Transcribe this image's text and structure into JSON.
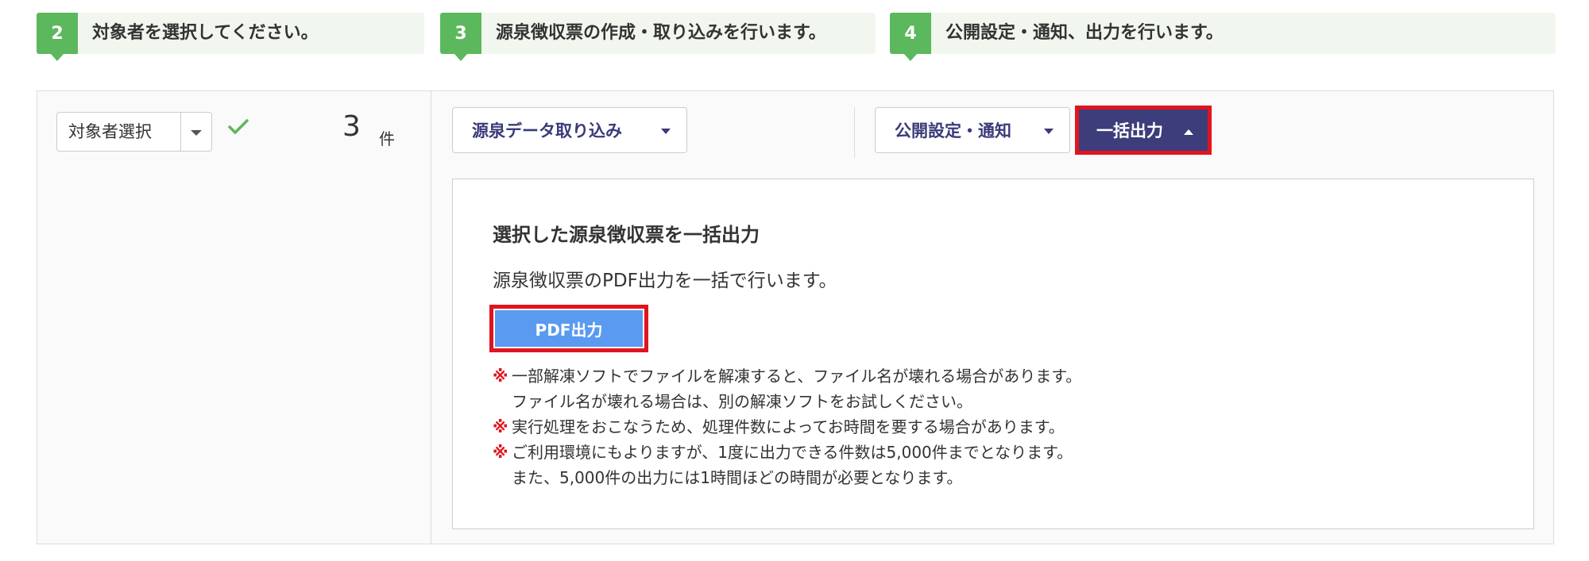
{
  "steps": [
    {
      "num": "2",
      "label": "対象者を選択してください。"
    },
    {
      "num": "3",
      "label": "源泉徴収票の作成・取り込みを行います。"
    },
    {
      "num": "4",
      "label": "公開設定・通知、出力を行います。"
    }
  ],
  "left": {
    "select_label": "対象者選択",
    "count": "3",
    "count_unit": "件"
  },
  "toolbar": {
    "import_label": "源泉データ取り込み",
    "publish_label": "公開設定・通知",
    "bulk_output_label": "一括出力"
  },
  "panel": {
    "title": "選択した源泉徴収票を一括出力",
    "description": "源泉徴収票のPDF出力を一括で行います。",
    "pdf_button": "PDF出力",
    "mark": "※",
    "notes": [
      "一部解凍ソフトでファイルを解凍すると、ファイル名が壊れる場合があります。",
      "ファイル名が壊れる場合は、別の解凍ソフトをお試しください。",
      "実行処理をおこなうため、処理件数によってお時間を要する場合があります。",
      "ご利用環境にもよりますが、1度に出力できる件数は5,000件までとなります。",
      "また、5,000件の出力には1時間ほどの時間が必要となります。"
    ]
  },
  "colors": {
    "step_green": "#5cb85c",
    "dark_button": "#3d3d7b",
    "pdf_button": "#5a9af0",
    "highlight": "#e0141e"
  }
}
